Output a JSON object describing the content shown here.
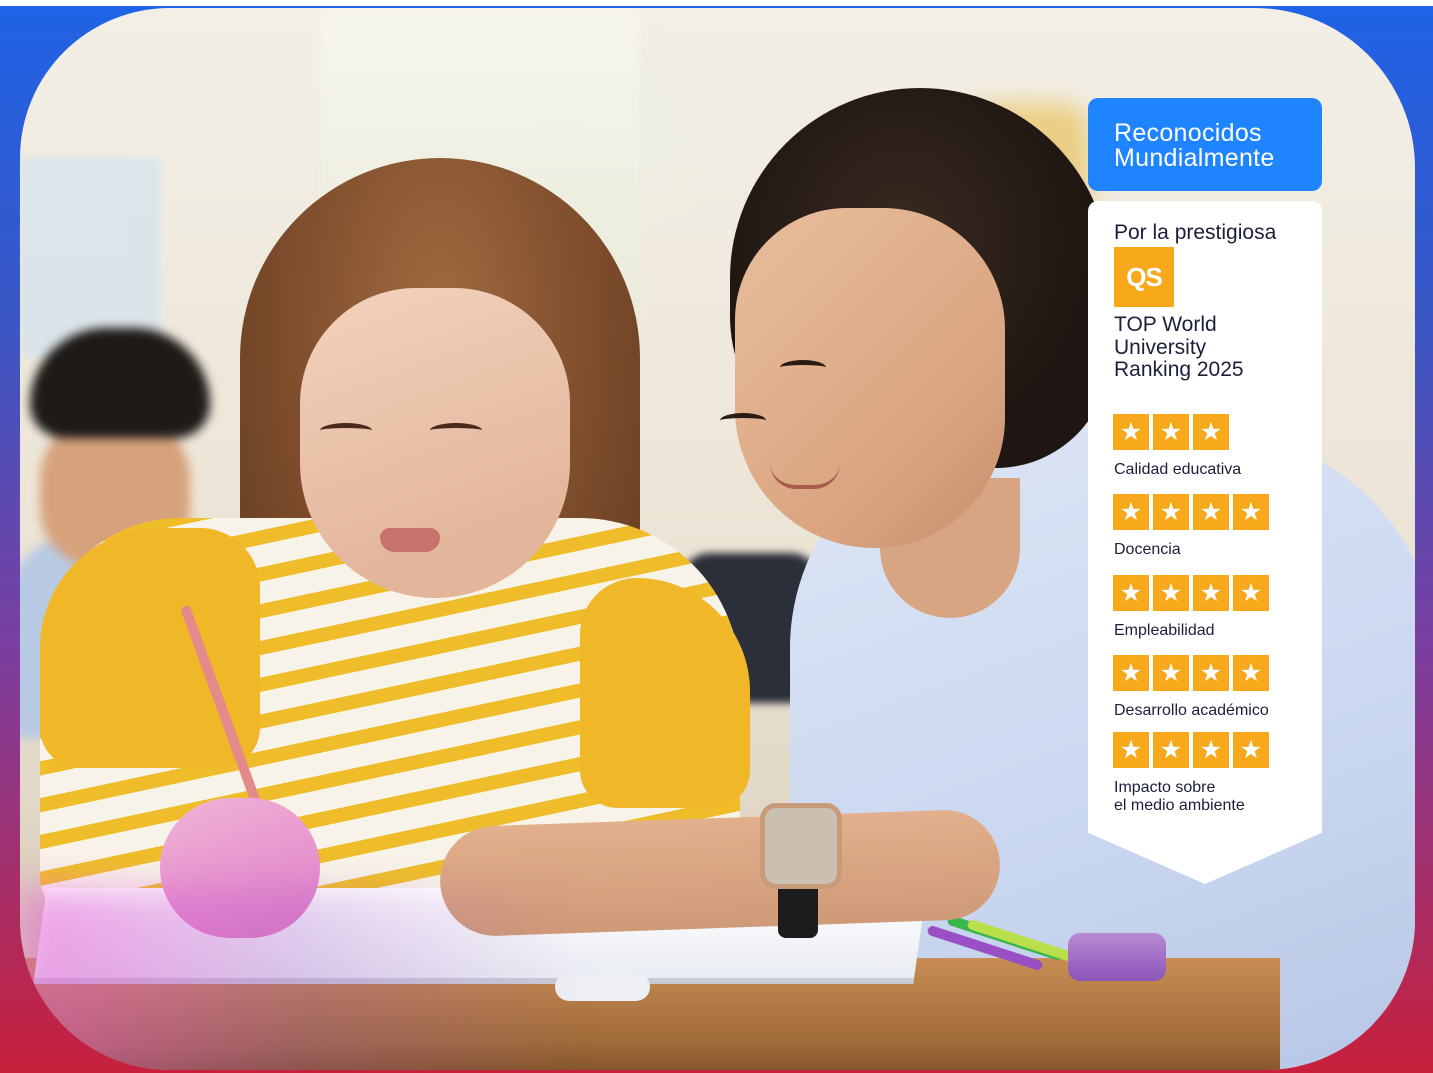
{
  "badge": {
    "header_line1": "Reconocidos",
    "header_line2": "Mundialmente",
    "intro": "Por la prestigiosa",
    "logo_text": "QS",
    "ranking_line1": "TOP World",
    "ranking_line2": "University",
    "ranking_line3": "Ranking 2025",
    "star_icon": "star-icon",
    "colors": {
      "header_bg": "#1e84ff",
      "star_bg": "#f7a81b",
      "logo_bg": "#f7a81b"
    },
    "criteria": [
      {
        "label_line1": "Calidad educativa",
        "label_line2": "",
        "stars": 3
      },
      {
        "label_line1": "Docencia",
        "label_line2": "",
        "stars": 4
      },
      {
        "label_line1": "Empleabilidad",
        "label_line2": "",
        "stars": 4
      },
      {
        "label_line1": "Desarrollo académico",
        "label_line2": "",
        "stars": 4
      },
      {
        "label_line1": "Impacto sobre",
        "label_line2": "el medio ambiente",
        "stars": 4
      }
    ]
  }
}
